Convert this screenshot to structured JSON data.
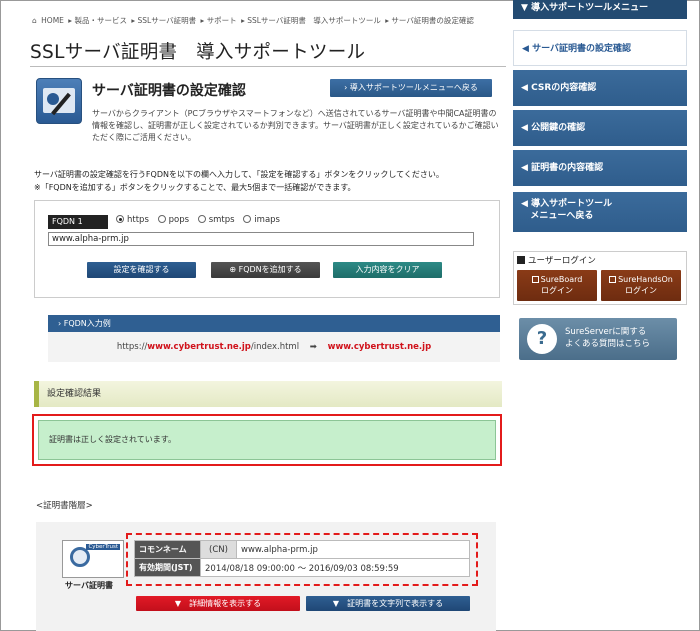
{
  "breadcrumb": [
    "HOME",
    "製品・サービス",
    "SSLサーバ証明書",
    "サポート",
    "SSLサーバ証明書　導入サポートツール",
    "サーバ証明書の設定確認"
  ],
  "page_title": "SSLサーバ証明書　導入サポートツール",
  "section": {
    "title": "サーバ証明書の設定確認",
    "menu_back_button": "導入サポートツールメニューへ戻る",
    "description": "サーバからクライアント（PCブラウザやスマートフォンなど）へ送信されているサーバ証明書や中間CA証明書の情報を確認し、証明書が正しく設定されているか判別できます。サーバ証明書が正しく設定されているかご確認いただく際にご活用ください。",
    "instruction_1": "サーバ証明書の設定確認を行うFQDNを以下の欄へ入力して、「設定を確認する」ボタンをクリックしてください。",
    "instruction_2": "※「FQDNを追加する」ボタンをクリックすることで、最大5個まで一括確認ができます。"
  },
  "form": {
    "fqdn_label": "FQDN 1",
    "protocols": [
      "https",
      "pops",
      "smtps",
      "imaps"
    ],
    "selected_protocol": "https",
    "fqdn_value": "www.alpha-prm.jp",
    "check_button": "設定を確認する",
    "add_button": "FQDNを追加する",
    "clear_button": "入力内容をクリア"
  },
  "example": {
    "title": "FQDN入力例",
    "prefix": "https://",
    "domain": "www.cybertrust.ne.jp",
    "suffix": "/index.html",
    "arrow": "➡",
    "result": "www.cybertrust.ne.jp"
  },
  "result": {
    "header": "設定確認結果",
    "message": "証明書は正しく設定されています。",
    "chain_label": "<証明書階層>"
  },
  "certificate": {
    "icon_badge": "CyberTrust",
    "label": "サーバ証明書",
    "cn_key": "コモンネーム",
    "cn_sub": "(CN)",
    "cn_value": "www.alpha-prm.jp",
    "validity_key": "有効期間(JST)",
    "validity_value": "2014/08/18 09:00:00 ～ 2016/09/03 08:59:59",
    "detail_button": "詳細情報を表示する",
    "text_button": "証明書を文字列で表示する"
  },
  "sidebar": {
    "menu_title": "導入サポートツールメニュー",
    "items": [
      {
        "label": "サーバ証明書の設定確認"
      },
      {
        "label": "CSRの内容確認"
      },
      {
        "label": "公開鍵の確認"
      },
      {
        "label": "証明書の内容確認"
      },
      {
        "label_line1": "導入サポートツール",
        "label_line2": "メニューへ戻る"
      }
    ],
    "login_title": "ユーザーログイン",
    "login_buttons": [
      {
        "line1": "SureBoard",
        "line2": "ログイン"
      },
      {
        "line1": "SureHandsOn",
        "line2": "ログイン"
      }
    ],
    "faq_line1": "SureServerに関する",
    "faq_line2": "よくある質問はこちら"
  },
  "colors": {
    "accent": "#2f5f92",
    "alert": "#e31b1b",
    "success_bg": "#c6efcc",
    "sidebar": "#2f5d8c"
  }
}
